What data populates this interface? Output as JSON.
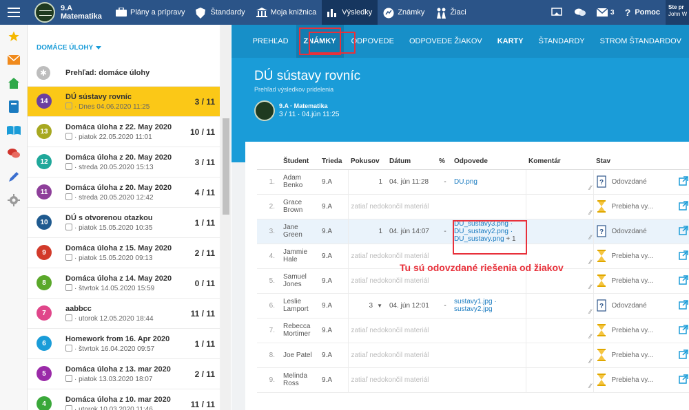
{
  "topbar": {
    "class_grade": "9.A",
    "class_subject": "Matematika",
    "nav": [
      {
        "label": "Plány a prípravy",
        "icon": "briefcase-icon"
      },
      {
        "label": "Štandardy",
        "icon": "shield-icon"
      },
      {
        "label": "Moja knižnica",
        "icon": "library-icon"
      },
      {
        "label": "Výsledky",
        "icon": "bar-chart-icon"
      },
      {
        "label": "Známky",
        "icon": "grades-icon"
      },
      {
        "label": "Žiaci",
        "icon": "students-icon"
      }
    ],
    "message_count": "3",
    "help_label": "Pomoc",
    "user_line1": "Ste pr",
    "user_line2": "John W"
  },
  "list": {
    "header": "DOMÁCE ÚLOHY",
    "overview_label": "Prehľad: domáce úlohy",
    "items": [
      {
        "num": "14",
        "color": "#6a3fa0",
        "title": "DÚ sústavy rovníc",
        "date": "· Dnes 04.06.2020 11:25",
        "count": "3 / 11"
      },
      {
        "num": "13",
        "color": "#a7a820",
        "title": "Domáca úloha z 22. May 2020",
        "date": "· piatok 22.05.2020 11:01",
        "count": "10 / 11"
      },
      {
        "num": "12",
        "color": "#1fa89a",
        "title": "Domáca úloha z 20. May 2020",
        "date": "· streda 20.05.2020 15:13",
        "count": "3 / 11"
      },
      {
        "num": "11",
        "color": "#8e3f9a",
        "title": "Domáca úloha z 20. May 2020",
        "date": "· streda 20.05.2020 12:42",
        "count": "4 / 11"
      },
      {
        "num": "10",
        "color": "#1f5a8f",
        "title": "DÚ s otvorenou otazkou",
        "date": "· piatok 15.05.2020 10:35",
        "count": "1 / 11"
      },
      {
        "num": "9",
        "color": "#d23a2a",
        "title": "Domáca úloha z 15. May 2020",
        "date": "· piatok 15.05.2020 09:13",
        "count": "2 / 11"
      },
      {
        "num": "8",
        "color": "#5aa82a",
        "title": "Domáca úloha z 14. May 2020",
        "date": "· štvrtok 14.05.2020 15:59",
        "count": "0 / 11"
      },
      {
        "num": "7",
        "color": "#e0468a",
        "title": "aabbcc",
        "date": "· utorok 12.05.2020 18:44",
        "count": "11 / 11"
      },
      {
        "num": "6",
        "color": "#1a9cd8",
        "title": "Homework from 16. Apr 2020",
        "date": "· štvrtok 16.04.2020 09:57",
        "count": "1 / 11"
      },
      {
        "num": "5",
        "color": "#9a2aa8",
        "title": "Domáca úloha z 13. mar 2020",
        "date": "· piatok 13.03.2020 18:07",
        "count": "2 / 11"
      },
      {
        "num": "4",
        "color": "#3aa83a",
        "title": "Domáca úloha z 10. mar 2020",
        "date": "· utorok 10.03.2020 11:46",
        "count": "11 / 11"
      }
    ]
  },
  "tabs": [
    "PREHĽAD",
    "ZNÁMKY",
    "ODPOVEDE",
    "ODPOVEDE ŽIAKOV",
    "KARTY",
    "ŠTANDARDY",
    "STROM ŠTANDARDOV"
  ],
  "header": {
    "title": "DÚ sústavy rovníc",
    "subtitle": "Prehľad výsledkov pridelenia",
    "class_line": "9.A · Matematika",
    "count_line": "3 / 11 · 04.jún 11:25"
  },
  "table": {
    "columns": [
      "Študent",
      "Trieda",
      "Pokusov",
      "Dátum",
      "%",
      "Odpovede",
      "Komentár",
      "Stav"
    ],
    "not_finished": "zatiaľ nedokončil materiál",
    "rows": [
      {
        "idx": "1.",
        "first": "Adam",
        "last": "Benko",
        "cls": "9.A",
        "tries": "1",
        "date": "04. jún 11:28",
        "pct": "-",
        "answers": [
          "DU.png"
        ],
        "more": "",
        "status": "Odovzdané",
        "status_type": "submitted"
      },
      {
        "idx": "2.",
        "first": "Grace",
        "last": "Brown",
        "cls": "9.A",
        "tries": "",
        "date": "",
        "pct": "",
        "answers": [],
        "more": "",
        "status": "Prebieha vy...",
        "status_type": "pending"
      },
      {
        "idx": "3.",
        "first": "Jane",
        "last": "Green",
        "cls": "9.A",
        "tries": "1",
        "date": "04. jún 14:07",
        "pct": "-",
        "answers": [
          "DU_sustavy3.png ·",
          "DU_sustavy2.png ·",
          "DU_sustavy.png"
        ],
        "more": "+ 1",
        "status": "Odovzdané",
        "status_type": "submitted"
      },
      {
        "idx": "4.",
        "first": "Jammie",
        "last": "Hale",
        "cls": "9.A",
        "tries": "",
        "date": "",
        "pct": "",
        "answers": [],
        "more": "",
        "status": "Prebieha vy...",
        "status_type": "pending"
      },
      {
        "idx": "5.",
        "first": "Samuel",
        "last": "Jones",
        "cls": "9.A",
        "tries": "",
        "date": "",
        "pct": "",
        "answers": [],
        "more": "",
        "status": "Prebieha vy...",
        "status_type": "pending"
      },
      {
        "idx": "6.",
        "first": "Leslie",
        "last": "Lamport",
        "cls": "9.A",
        "tries": "3",
        "date": "04. jún 12:01",
        "pct": "-",
        "answers": [
          "sustavy1.jpg ·",
          "sustavy2.jpg"
        ],
        "more": "",
        "status": "Odovzdané",
        "status_type": "submitted"
      },
      {
        "idx": "7.",
        "first": "Rebecca",
        "last": "Mortimer",
        "cls": "9.A",
        "tries": "",
        "date": "",
        "pct": "",
        "answers": [],
        "more": "",
        "status": "Prebieha vy...",
        "status_type": "pending"
      },
      {
        "idx": "8.",
        "first": "Joe Patel",
        "last": "",
        "cls": "9.A",
        "tries": "",
        "date": "",
        "pct": "",
        "answers": [],
        "more": "",
        "status": "Prebieha vy...",
        "status_type": "pending"
      },
      {
        "idx": "9.",
        "first": "Melinda",
        "last": "Ross",
        "cls": "9.A",
        "tries": "",
        "date": "",
        "pct": "",
        "answers": [],
        "more": "",
        "status": "Prebieha vy...",
        "status_type": "pending"
      }
    ]
  },
  "annotation": "Tu sú odovzdané riešenia od žiakov",
  "colors": {
    "topbar": "#2b5488",
    "accent": "#1a9cd8",
    "active_item": "#fbc817",
    "highlight": "#e8303a"
  }
}
